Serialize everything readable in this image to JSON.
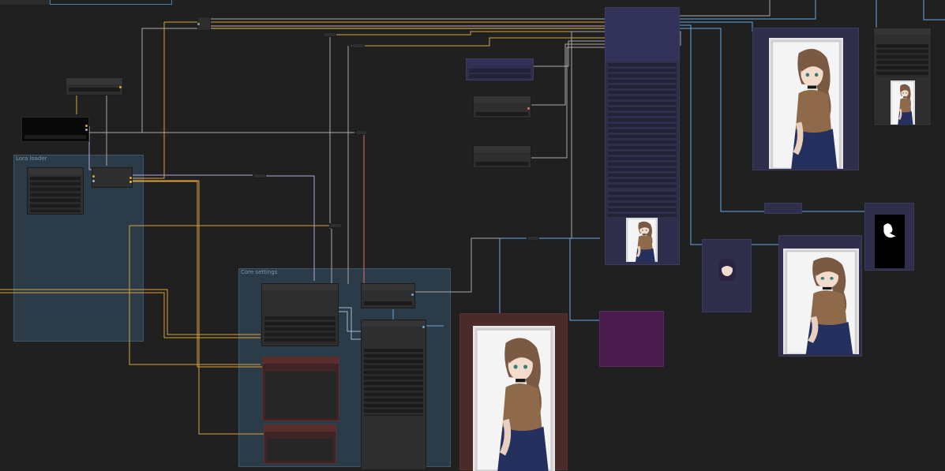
{
  "canvas": {
    "background": "#202020",
    "wire_colors": {
      "image": "#64a9e0",
      "model": "#d9a13c",
      "clip": "#e3c34e",
      "conditioning": "#b7a4d8",
      "vae": "#e46f6f",
      "latent": "#d99fb6",
      "generic": "#a8a8a8"
    }
  },
  "groups": [
    {
      "id": "lora-loader",
      "title": "Lora loader",
      "color": "#2c3b48"
    },
    {
      "id": "core-settings",
      "title": "Core settings",
      "color": "#2c3b48"
    }
  ],
  "nodes": {
    "black_text_node": {
      "color": "#080808"
    },
    "preview_node_caption": "",
    "palette": {
      "blue": "#2f2f4c",
      "red": "#3f2424",
      "purple": "#4a1c4e",
      "grey": "#2e2e2e"
    }
  },
  "previews": {
    "icon_name": "anime-girl-portrait-image",
    "mask_icon_name": "mask-silhouette-image"
  }
}
